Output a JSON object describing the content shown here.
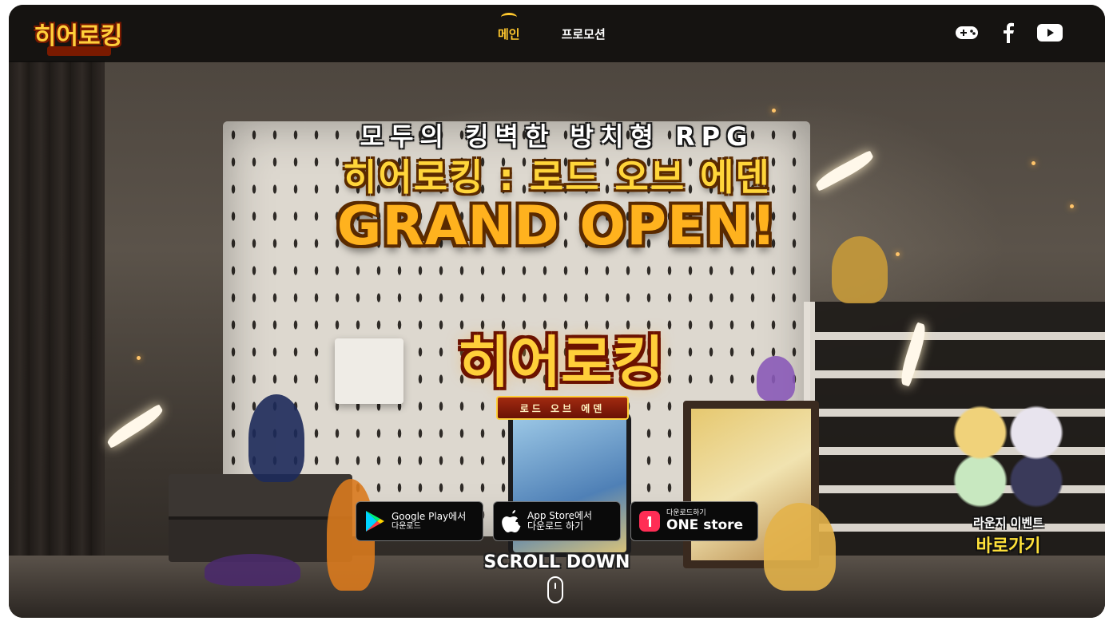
{
  "header": {
    "logo_text": "히어로킹",
    "nav": [
      {
        "label": "메인",
        "active": true
      },
      {
        "label": "프로모션",
        "active": false
      }
    ],
    "social": [
      {
        "icon": "gamepad-lounge-icon"
      },
      {
        "icon": "facebook-icon"
      },
      {
        "icon": "youtube-icon"
      }
    ]
  },
  "hero": {
    "tagline": "모두의 킹벽한 방치형 RPG",
    "title": "히어로킹 : 로드 오브 에덴",
    "subtitle": "GRAND OPEN!",
    "game_logo": "히어로킹",
    "game_logo_ribbon": "로드 오브 에덴"
  },
  "stores": {
    "google": {
      "line1": "Google Play에서",
      "line2": "다운로드"
    },
    "apple": {
      "line1": "App Store에서",
      "line2": "다운로드 하기"
    },
    "onestore": {
      "line1": "다운로드하기",
      "line2": "ONE store"
    }
  },
  "scroll": {
    "label": "SCROLL DOWN"
  },
  "lounge": {
    "line1": "라운지 이벤트",
    "line2": "바로가기"
  },
  "colors": {
    "accent": "#ffc82e",
    "header_bg": "#0e0c0b"
  }
}
